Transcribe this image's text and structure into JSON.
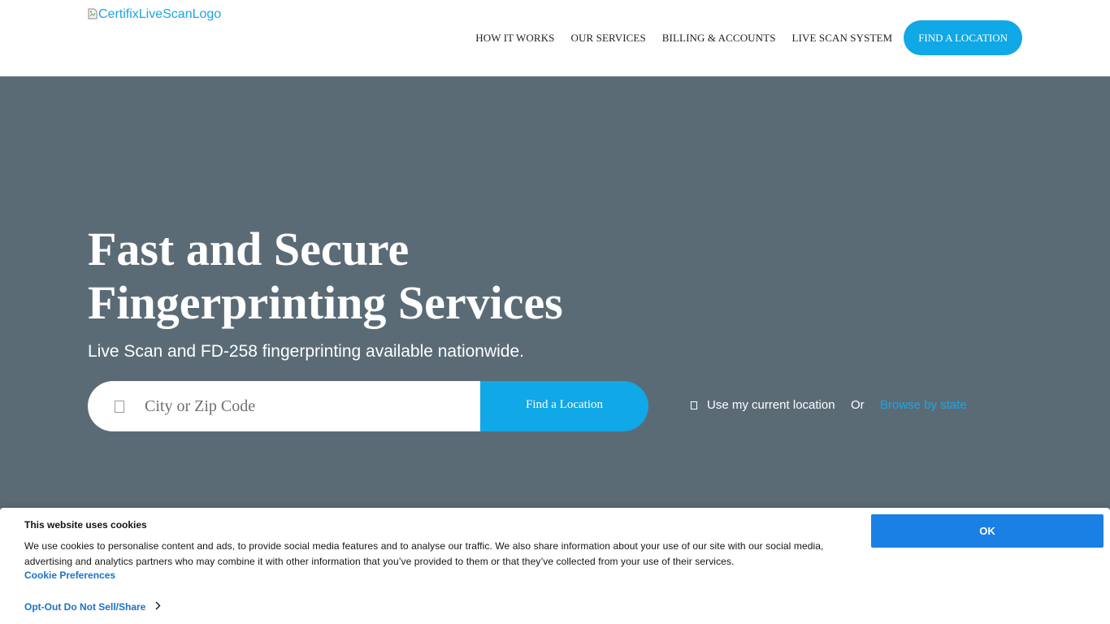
{
  "header": {
    "logo_alt": "CertifixLiveScanLogo",
    "nav": [
      {
        "label": "HOW IT WORKS"
      },
      {
        "label": "OUR SERVICES"
      },
      {
        "label": "BILLING & ACCOUNTS"
      },
      {
        "label": "LIVE SCAN SYSTEM"
      }
    ],
    "cta_label": "FIND A LOCATION"
  },
  "hero": {
    "title_line1": "Fast and Secure",
    "title_line2": "Fingerprinting Services",
    "subtitle": "Live Scan and FD-258 fingerprinting available nationwide.",
    "search_placeholder": "City or Zip Code",
    "find_button": "Find a Location",
    "use_location": "Use my current location",
    "or_text": "Or",
    "browse_link": "Browse by state"
  },
  "cookie_banner": {
    "title": "This website uses cookies",
    "text": "We use cookies to personalise content and ads, to provide social media features and to analyse our traffic. We also share information about your use of our site with our social media, advertising and analytics partners who may combine it with other information that you’ve provided to them or that they’ve collected from your use of their services.",
    "preferences_link": "Cookie Preferences",
    "optout_link": "Opt-Out Do Not Sell/Share",
    "ok_button": "OK"
  },
  "colors": {
    "hero_bg": "#5b6b76",
    "accent": "#10a8e6",
    "cookie_button": "#1a80e3",
    "link": "#1a73c8"
  },
  "icons": {
    "logo": "broken-image-icon",
    "search": "map-pin-icon",
    "location": "location-icon",
    "optout": "chevron-right-icon"
  }
}
